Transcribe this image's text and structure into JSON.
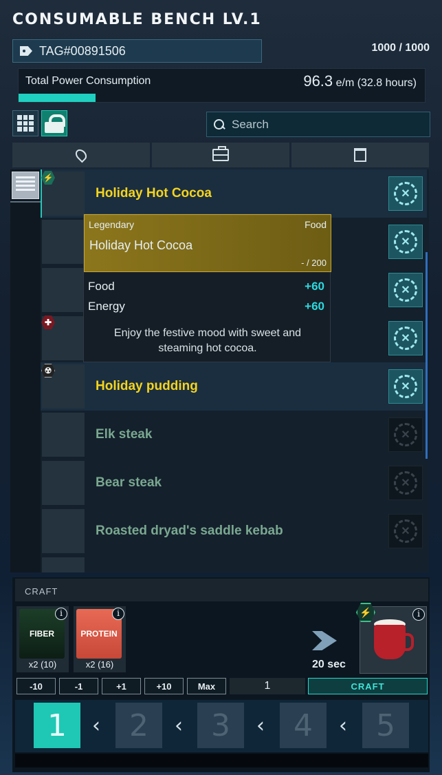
{
  "header": {
    "title": "CONSUMABLE BENCH LV.1",
    "tag": "TAG#00891506",
    "capacity": "1000 / 1000"
  },
  "power": {
    "label": "Total Power Consumption",
    "value": "96.3",
    "unit": "e/m (32.8 hours)",
    "fill_fraction": 0.19
  },
  "search": {
    "placeholder": "Search"
  },
  "icons": {
    "view_grid": "grid-icon",
    "lock": "lock-icon",
    "filter_location": "location-pin-icon",
    "filter_kit": "toolkit-icon",
    "filter_storage": "storage-bin-icon",
    "list_mode": "list-view-icon",
    "craft_action": "craft-tools-icon"
  },
  "items": [
    {
      "name": "Holiday Hot Cocoa",
      "color": "gold",
      "available": true,
      "badge": "power"
    },
    {
      "name": "",
      "color": "gold",
      "available": true,
      "badge": ""
    },
    {
      "name": "",
      "color": "gold",
      "available": true,
      "badge": ""
    },
    {
      "name": "",
      "color": "gold",
      "available": true,
      "badge": "health"
    },
    {
      "name": "Holiday pudding",
      "color": "gold",
      "available": true,
      "badge": "hazard"
    },
    {
      "name": "Elk steak",
      "color": "green",
      "available": false,
      "badge": ""
    },
    {
      "name": "Bear steak",
      "color": "green",
      "available": false,
      "badge": ""
    },
    {
      "name": "Roasted dryad's saddle kebab",
      "color": "green",
      "available": false,
      "badge": ""
    }
  ],
  "tooltip": {
    "rarity": "Legendary",
    "category": "Food",
    "name": "Holiday Hot Cocoa",
    "durability": "- / 200",
    "stats": [
      {
        "label": "Food",
        "value": "+60"
      },
      {
        "label": "Energy",
        "value": "+60"
      }
    ],
    "description": "Enjoy the festive mood with sweet and steaming hot cocoa."
  },
  "craft": {
    "title": "CRAFT",
    "ingredients": [
      {
        "label": "FIBER",
        "qty": "x2 (10)"
      },
      {
        "label": "PROTEIN",
        "qty": "x2 (16)"
      }
    ],
    "time": "20 sec",
    "buttons": [
      "-10",
      "-1",
      "+1",
      "+10",
      "Max"
    ],
    "quantity": "1",
    "craft_label": "CRAFT"
  },
  "tiers": {
    "numbers": [
      "1",
      "2",
      "3",
      "4",
      "5"
    ],
    "active": "1"
  },
  "colors": {
    "accent": "#1fc8b4",
    "gold_text": "#f5d41c",
    "unavailable_text": "#7aa890",
    "stat_value": "#2ed9e0"
  }
}
